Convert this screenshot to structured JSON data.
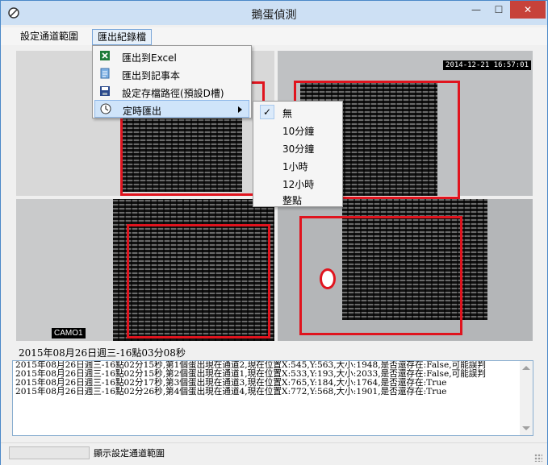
{
  "window": {
    "title": "鵝蛋偵測",
    "close_label": "✕",
    "minimize_label": "—",
    "maximize_label": "☐"
  },
  "menubar": {
    "setup": "設定通道範圍",
    "export": "匯出紀錄檔"
  },
  "export_menu": {
    "items": [
      {
        "label": "匯出到Excel",
        "icon": "excel-icon"
      },
      {
        "label": "匯出到記事本",
        "icon": "notepad-icon"
      },
      {
        "label": "設定存檔路徑(預設D槽)",
        "icon": "save-icon"
      },
      {
        "label": "定時匯出",
        "icon": "clock-icon",
        "has_submenu": true
      }
    ]
  },
  "timer_submenu": {
    "selected": "無",
    "items": [
      "無",
      "10分鐘",
      "30分鐘",
      "1小時",
      "12小時",
      "整點"
    ]
  },
  "video": {
    "timestamp": "2014-12-21 16:57:01",
    "camera": "CAMO1"
  },
  "current_time": "2015年08月26日週三-16點03分08秒",
  "log": [
    "2015年08月26日週三-16點02分15秒,第1個蛋出現在通道2,現在位置X:545,Y:563,大小:1948,是否還存在:False,可能誤判",
    "2015年08月26日週三-16點02分15秒,第2個蛋出現在通道1,現在位置X:533,Y:193,大小:2033,是否還存在:False,可能誤判",
    "2015年08月26日週三-16點02分17秒,第3個蛋出現在通道3,現在位置X:765,Y:184,大小:1764,是否還存在:True",
    "2015年08月26日週三-16點02分26秒,第4個蛋出現在通道4,現在位置X:772,Y:568,大小:1901,是否還存在:True"
  ],
  "statusbar": {
    "text": "顯示設定通道範圍"
  },
  "colors": {
    "detection_box": "#e0141e",
    "title_bar": "#cde0f4",
    "close_button": "#c7423a"
  }
}
